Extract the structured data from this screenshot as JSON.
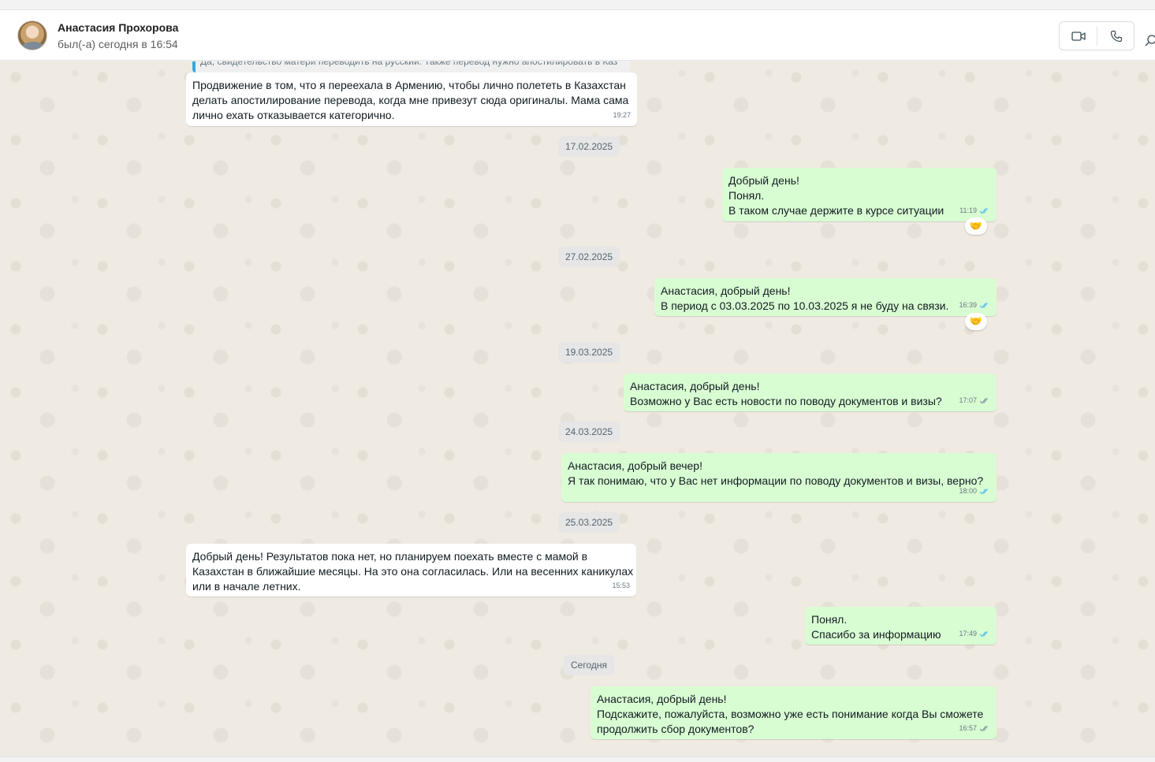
{
  "header": {
    "contact_name": "Анастасия Прохорова",
    "status": "был(-а) сегодня в 16:54",
    "icons": [
      "video-call-icon",
      "voice-call-icon",
      "search-icon"
    ]
  },
  "quoted_fragment": "Да, свидетельство матери переводить на русский. Также перевод нужно апостилировать в Каз",
  "messages": [
    {
      "dir": "in",
      "lines": [
        "Продвижение в том, что я переехала в Армению, чтобы лично полететь в Казахстан",
        "делать апостилирование перевода, когда мне привезут сюда оригиналы. Мама сама",
        "лично ехать отказывается категорично."
      ],
      "time": "19:27"
    },
    {
      "date": "17.02.2025"
    },
    {
      "dir": "out",
      "lines": [
        "Добрый день!",
        "Понял.",
        "В таком случае держите в курсе ситуации"
      ],
      "time": "11:19",
      "read": true,
      "reaction": "🤝"
    },
    {
      "date": "27.02.2025"
    },
    {
      "dir": "out",
      "lines": [
        "Анастасия, добрый день!",
        "В период с 03.03.2025 по 10.03.2025 я не буду на связи."
      ],
      "time": "16:39",
      "read": true,
      "reaction": "🤝"
    },
    {
      "date": "19.03.2025"
    },
    {
      "dir": "out",
      "lines": [
        "Анастасия, добрый день!",
        "Возможно у Вас есть новости по поводу документов и визы?"
      ],
      "time": "17:07",
      "read": false
    },
    {
      "date": "24.03.2025"
    },
    {
      "dir": "out",
      "lines": [
        "Анастасия, добрый вечер!",
        "Я так понимаю, что у Вас нет информации по поводу документов и визы, верно?"
      ],
      "time": "18:00",
      "read": true
    },
    {
      "date": "25.03.2025"
    },
    {
      "dir": "in",
      "lines": [
        "Добрый день! Результатов пока нет, но планируем поехать вместе с мамой в",
        "Казахстан в ближайшие месяцы. На это она согласилась. Или на весенних каникулах",
        "или в начале летних."
      ],
      "time": "15:53"
    },
    {
      "dir": "out",
      "lines": [
        "Понял.",
        "Спасибо за информацию"
      ],
      "time": "17:49",
      "read": true
    },
    {
      "date": "Сегодня"
    },
    {
      "dir": "out",
      "lines": [
        "Анастасия, добрый день!",
        "Подскажите, пожалуйста, возможно уже есть понимание когда Вы сможете",
        "продолжить сбор документов?"
      ],
      "time": "16:57",
      "read": false
    }
  ],
  "colors": {
    "incoming": "#ffffff",
    "outgoing": "#d9fdd3",
    "tick_read": "#53bdeb",
    "tick_delivered": "#8696a0",
    "quote_bar": "#35a9e0"
  }
}
